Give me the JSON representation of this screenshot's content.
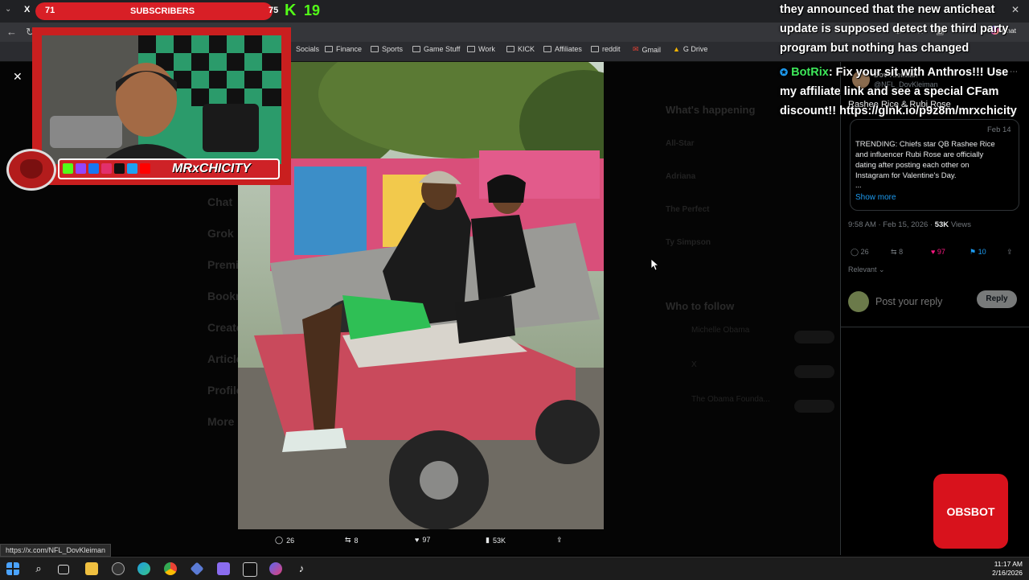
{
  "browser": {
    "tab_count_badge": "X",
    "bookmarks": [
      "Socials",
      "Finance",
      "Sports",
      "Game Stuff",
      "Work",
      "KICK",
      "Affiliates",
      "reddit",
      "Gmail",
      "G Drive"
    ],
    "chat_label": "Chat"
  },
  "stream": {
    "subscribers_label": "SUBSCRIBERS",
    "sub_current": "71",
    "sub_goal": "75",
    "kick_count": "19",
    "streamer_name": "MRxCHICITY",
    "chat_overlay_line1": "they announced that the new anticheat update is supposed detect the third party program but nothing has changed",
    "bot_name": "BotRix",
    "bot_message": ": Fix your sit with Anthros!!! Use my affiliate link and see a special CFam discount!! https://glnk.io/p9z8m/mrxchicity",
    "sponsor": "OBSBOT"
  },
  "x_sidebar_ghost": [
    "Chat",
    "Grok",
    "Premium",
    "Bookmarks",
    "Creator Studio",
    "Articles",
    "Profile",
    "More"
  ],
  "x_trends_ghost": {
    "heading": "What's happening",
    "trends": [
      "All-Star",
      "Adriana",
      "The Perfect",
      "Ty Simpson"
    ],
    "follow_heading": "Who to follow",
    "follow_names": [
      "Michelle Obama",
      "X",
      "The Obama Founda..."
    ],
    "follow_label": "Follow"
  },
  "post": {
    "author": "Dov Kleiman",
    "handle": "@NFL_DovKleiman",
    "text": "Rashee Rice & Rubi Rose",
    "quote_date": "Feb 14",
    "quote_text": "TRENDING: Chiefs star QB Rashee Rice and influencer Rubi Rose are officially dating after posting each other on Instagram for Valentine's Day.",
    "quote_more": "...",
    "show_more": "Show more",
    "timestamp": "9:58 AM · Feb 15, 2026 ·",
    "views": "53K",
    "views_label": "Views",
    "replies": "26",
    "reposts": "8",
    "likes": "97",
    "bookmarks": "10",
    "sort": "Relevant",
    "reply_placeholder": "Post your reply",
    "reply_button": "Reply"
  },
  "media_bar": {
    "replies": "26",
    "reposts": "8",
    "likes": "97",
    "views": "53K"
  },
  "status_url": "https://x.com/NFL_DovKleiman",
  "taskbar": {
    "time": "11:17 AM",
    "date": "2/16/2026"
  },
  "colors": {
    "x_like": "#f91880",
    "x_bookmark": "#1d9bf0",
    "stream_red": "#c91f1f",
    "kick_green": "#53fc18",
    "botrix_green": "#3ee85a"
  }
}
